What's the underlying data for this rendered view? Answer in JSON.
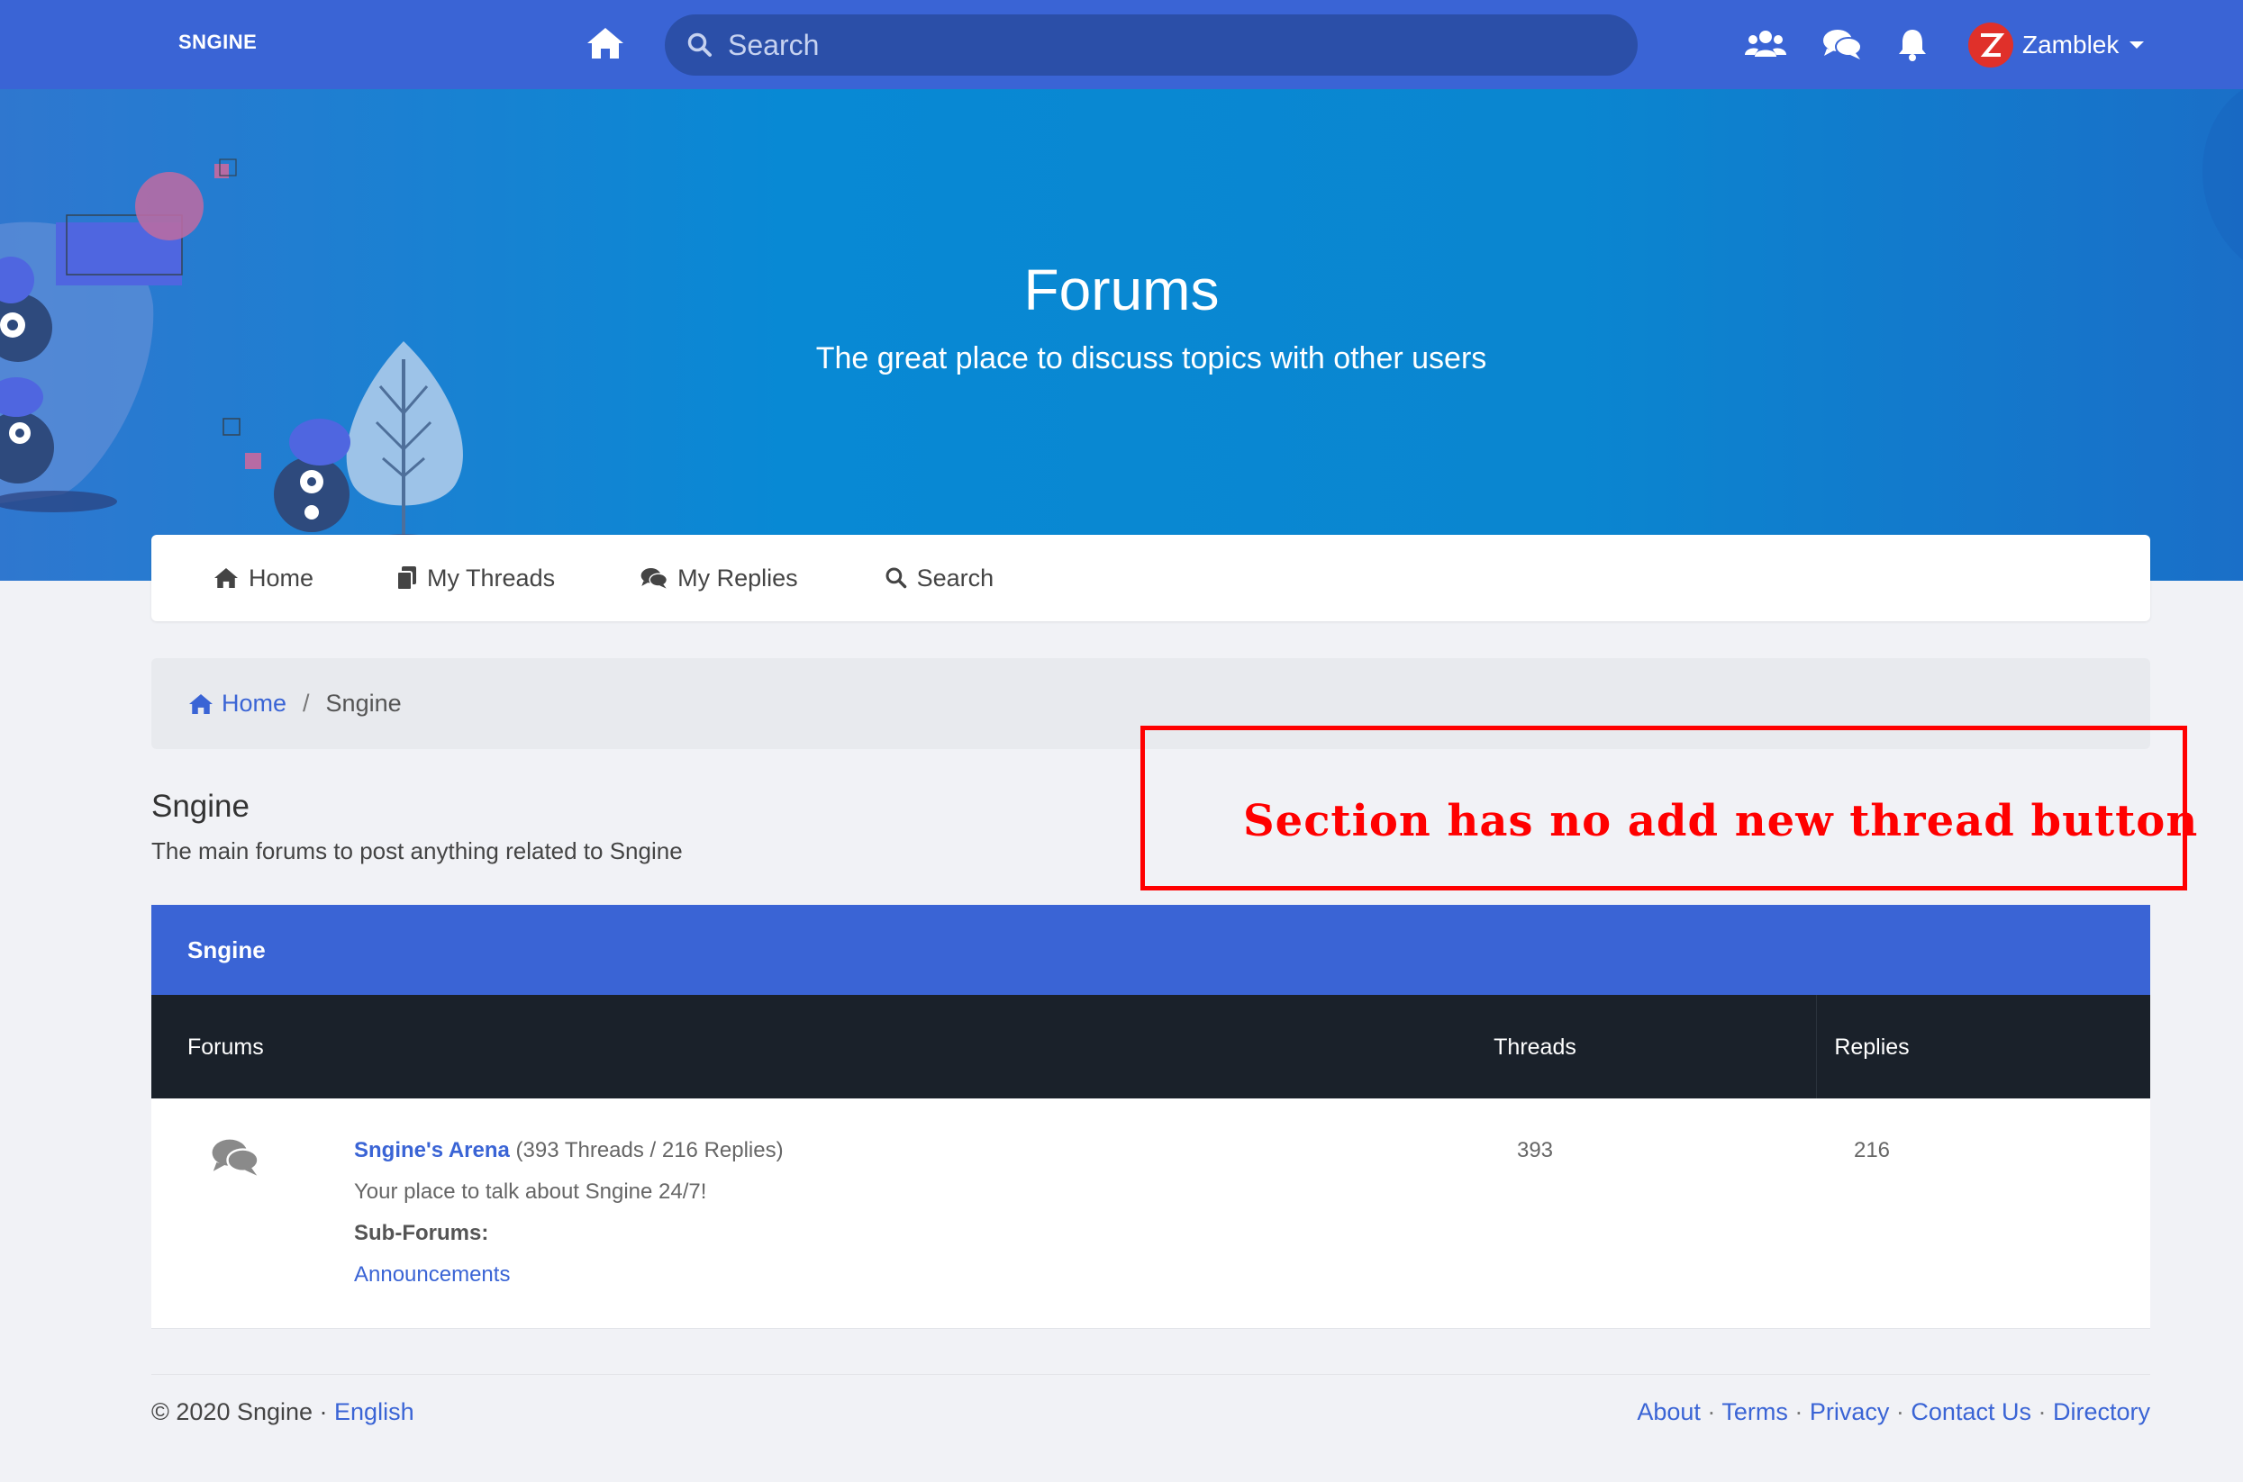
{
  "navbar": {
    "brand": "SNGINE",
    "search_placeholder": "Search",
    "user_name": "Zamblek",
    "icons": [
      "home-icon",
      "users-icon",
      "comments-icon",
      "bell-icon",
      "chevron-down-icon"
    ]
  },
  "hero": {
    "title": "Forums",
    "subtitle": "The great place to discuss topics with other users"
  },
  "tabs": [
    {
      "label": "Home",
      "icon": "home-icon"
    },
    {
      "label": "My Threads",
      "icon": "copy-icon"
    },
    {
      "label": "My Replies",
      "icon": "comments-icon"
    },
    {
      "label": "Search",
      "icon": "search-icon"
    }
  ],
  "breadcrumb": {
    "home": "Home",
    "separator": "/",
    "current": "Sngine"
  },
  "section": {
    "title": "Sngine",
    "description": "The main forums to post anything related to Sngine"
  },
  "annotation": {
    "text": "Section has no add new thread button",
    "color": "#ff0000"
  },
  "table": {
    "header": "Sngine",
    "columns": {
      "forums": "Forums",
      "threads": "Threads",
      "replies": "Replies"
    },
    "rows": [
      {
        "name": "Sngine's Arena",
        "counts": "(393 Threads / 216 Replies)",
        "description": "Your place to talk about Sngine 24/7!",
        "subforums_label": "Sub-Forums:",
        "subforum": "Announcements",
        "threads": "393",
        "replies": "216"
      }
    ]
  },
  "footer": {
    "copyright": "© 2020 Sngine · ",
    "language": "English",
    "links": [
      "About",
      "Terms",
      "Privacy",
      "Contact Us",
      "Directory"
    ],
    "separator": " · "
  },
  "colors": {
    "primary": "#3a64d5",
    "dark_header": "#1a212a",
    "background": "#f1f2f6"
  }
}
